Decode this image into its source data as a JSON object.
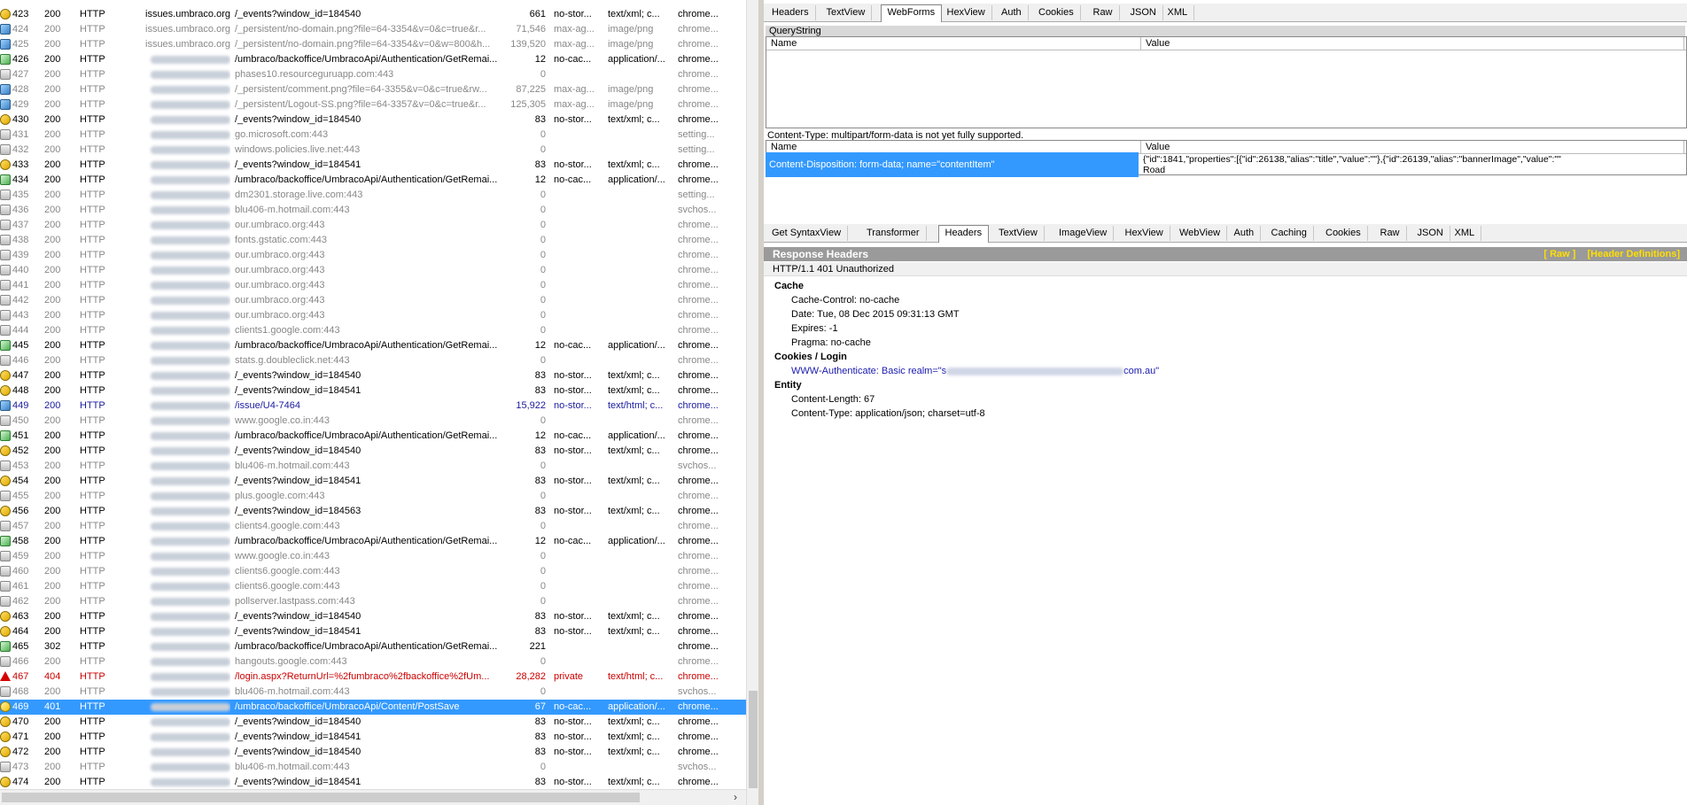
{
  "sessions": [
    {
      "num": "423",
      "result": "200",
      "protocol": "HTTP",
      "host": "issues.umbraco.org",
      "host_blurred": false,
      "url": "/_events?window_id=184540",
      "body": "661",
      "caching": "no-stor...",
      "ctype": "text/xml; c...",
      "process": "chrome...",
      "icon": "get",
      "style": "normal"
    },
    {
      "num": "424",
      "result": "200",
      "protocol": "HTTP",
      "host": "issues.umbraco.org",
      "host_blurred": false,
      "url": "/_persistent/no-domain.png?file=64-3354&v=0&c=true&r...",
      "body": "71,546",
      "caching": "max-ag...",
      "ctype": "image/png",
      "process": "chrome...",
      "icon": "img",
      "style": "dim"
    },
    {
      "num": "425",
      "result": "200",
      "protocol": "HTTP",
      "host": "issues.umbraco.org",
      "host_blurred": false,
      "url": "/_persistent/no-domain.png?file=64-3354&v=0&w=800&h...",
      "body": "139,520",
      "caching": "max-ag...",
      "ctype": "image/png",
      "process": "chrome...",
      "icon": "img",
      "style": "dim"
    },
    {
      "num": "426",
      "result": "200",
      "protocol": "HTTP",
      "host": "",
      "host_blurred": true,
      "url": "/umbraco/backoffice/UmbracoApi/Authentication/GetRemai...",
      "body": "12",
      "caching": "no-cac...",
      "ctype": "application/...",
      "process": "chrome...",
      "icon": "js",
      "style": "normal"
    },
    {
      "num": "427",
      "result": "200",
      "protocol": "HTTP",
      "host": "",
      "host_blurred": true,
      "url": "phases10.resourceguruapp.com:443",
      "body": "0",
      "caching": "",
      "ctype": "",
      "process": "chrome...",
      "icon": "lock",
      "style": "dim"
    },
    {
      "num": "428",
      "result": "200",
      "protocol": "HTTP",
      "host": "",
      "host_blurred": true,
      "url": "/_persistent/comment.png?file=64-3355&v=0&c=true&rw...",
      "body": "87,225",
      "caching": "max-ag...",
      "ctype": "image/png",
      "process": "chrome...",
      "icon": "img",
      "style": "dim"
    },
    {
      "num": "429",
      "result": "200",
      "protocol": "HTTP",
      "host": "",
      "host_blurred": true,
      "url": "/_persistent/Logout-SS.png?file=64-3357&v=0&c=true&r...",
      "body": "125,305",
      "caching": "max-ag...",
      "ctype": "image/png",
      "process": "chrome...",
      "icon": "img",
      "style": "dim"
    },
    {
      "num": "430",
      "result": "200",
      "protocol": "HTTP",
      "host": "",
      "host_blurred": true,
      "url": "/_events?window_id=184540",
      "body": "83",
      "caching": "no-stor...",
      "ctype": "text/xml; c...",
      "process": "chrome...",
      "icon": "get",
      "style": "normal"
    },
    {
      "num": "431",
      "result": "200",
      "protocol": "HTTP",
      "host": "",
      "host_blurred": true,
      "url": "go.microsoft.com:443",
      "body": "0",
      "caching": "",
      "ctype": "",
      "process": "setting...",
      "icon": "lock",
      "style": "dim"
    },
    {
      "num": "432",
      "result": "200",
      "protocol": "HTTP",
      "host": "",
      "host_blurred": true,
      "url": "windows.policies.live.net:443",
      "body": "0",
      "caching": "",
      "ctype": "",
      "process": "setting...",
      "icon": "lock",
      "style": "dim"
    },
    {
      "num": "433",
      "result": "200",
      "protocol": "HTTP",
      "host": "",
      "host_blurred": true,
      "url": "/_events?window_id=184541",
      "body": "83",
      "caching": "no-stor...",
      "ctype": "text/xml; c...",
      "process": "chrome...",
      "icon": "get",
      "style": "normal"
    },
    {
      "num": "434",
      "result": "200",
      "protocol": "HTTP",
      "host": "",
      "host_blurred": true,
      "url": "/umbraco/backoffice/UmbracoApi/Authentication/GetRemai...",
      "body": "12",
      "caching": "no-cac...",
      "ctype": "application/...",
      "process": "chrome...",
      "icon": "js",
      "style": "normal"
    },
    {
      "num": "435",
      "result": "200",
      "protocol": "HTTP",
      "host": "",
      "host_blurred": true,
      "url": "dm2301.storage.live.com:443",
      "body": "0",
      "caching": "",
      "ctype": "",
      "process": "setting...",
      "icon": "lock",
      "style": "dim"
    },
    {
      "num": "436",
      "result": "200",
      "protocol": "HTTP",
      "host": "",
      "host_blurred": true,
      "url": "blu406-m.hotmail.com:443",
      "body": "0",
      "caching": "",
      "ctype": "",
      "process": "svchos...",
      "icon": "lock",
      "style": "dim"
    },
    {
      "num": "437",
      "result": "200",
      "protocol": "HTTP",
      "host": "",
      "host_blurred": true,
      "url": "our.umbraco.org:443",
      "body": "0",
      "caching": "",
      "ctype": "",
      "process": "chrome...",
      "icon": "lock",
      "style": "dim"
    },
    {
      "num": "438",
      "result": "200",
      "protocol": "HTTP",
      "host": "",
      "host_blurred": true,
      "url": "fonts.gstatic.com:443",
      "body": "0",
      "caching": "",
      "ctype": "",
      "process": "chrome...",
      "icon": "lock",
      "style": "dim"
    },
    {
      "num": "439",
      "result": "200",
      "protocol": "HTTP",
      "host": "",
      "host_blurred": true,
      "url": "our.umbraco.org:443",
      "body": "0",
      "caching": "",
      "ctype": "",
      "process": "chrome...",
      "icon": "lock",
      "style": "dim"
    },
    {
      "num": "440",
      "result": "200",
      "protocol": "HTTP",
      "host": "",
      "host_blurred": true,
      "url": "our.umbraco.org:443",
      "body": "0",
      "caching": "",
      "ctype": "",
      "process": "chrome...",
      "icon": "lock",
      "style": "dim"
    },
    {
      "num": "441",
      "result": "200",
      "protocol": "HTTP",
      "host": "",
      "host_blurred": true,
      "url": "our.umbraco.org:443",
      "body": "0",
      "caching": "",
      "ctype": "",
      "process": "chrome...",
      "icon": "lock",
      "style": "dim"
    },
    {
      "num": "442",
      "result": "200",
      "protocol": "HTTP",
      "host": "",
      "host_blurred": true,
      "url": "our.umbraco.org:443",
      "body": "0",
      "caching": "",
      "ctype": "",
      "process": "chrome...",
      "icon": "lock",
      "style": "dim"
    },
    {
      "num": "443",
      "result": "200",
      "protocol": "HTTP",
      "host": "",
      "host_blurred": true,
      "url": "our.umbraco.org:443",
      "body": "0",
      "caching": "",
      "ctype": "",
      "process": "chrome...",
      "icon": "lock",
      "style": "dim"
    },
    {
      "num": "444",
      "result": "200",
      "protocol": "HTTP",
      "host": "",
      "host_blurred": true,
      "url": "clients1.google.com:443",
      "body": "0",
      "caching": "",
      "ctype": "",
      "process": "chrome...",
      "icon": "lock",
      "style": "dim"
    },
    {
      "num": "445",
      "result": "200",
      "protocol": "HTTP",
      "host": "",
      "host_blurred": true,
      "url": "/umbraco/backoffice/UmbracoApi/Authentication/GetRemai...",
      "body": "12",
      "caching": "no-cac...",
      "ctype": "application/...",
      "process": "chrome...",
      "icon": "js",
      "style": "normal"
    },
    {
      "num": "446",
      "result": "200",
      "protocol": "HTTP",
      "host": "",
      "host_blurred": true,
      "url": "stats.g.doubleclick.net:443",
      "body": "0",
      "caching": "",
      "ctype": "",
      "process": "chrome...",
      "icon": "lock",
      "style": "dim"
    },
    {
      "num": "447",
      "result": "200",
      "protocol": "HTTP",
      "host": "",
      "host_blurred": true,
      "url": "/_events?window_id=184540",
      "body": "83",
      "caching": "no-stor...",
      "ctype": "text/xml; c...",
      "process": "chrome...",
      "icon": "get",
      "style": "normal"
    },
    {
      "num": "448",
      "result": "200",
      "protocol": "HTTP",
      "host": "",
      "host_blurred": true,
      "url": "/_events?window_id=184541",
      "body": "83",
      "caching": "no-stor...",
      "ctype": "text/xml; c...",
      "process": "chrome...",
      "icon": "get",
      "style": "normal"
    },
    {
      "num": "449",
      "result": "200",
      "protocol": "HTTP",
      "host": "",
      "host_blurred": true,
      "url": "/issue/U4-7464",
      "body": "15,922",
      "caching": "no-stor...",
      "ctype": "text/html; c...",
      "process": "chrome...",
      "icon": "img",
      "style": "navy"
    },
    {
      "num": "450",
      "result": "200",
      "protocol": "HTTP",
      "host": "",
      "host_blurred": true,
      "url": "www.google.co.in:443",
      "body": "0",
      "caching": "",
      "ctype": "",
      "process": "chrome...",
      "icon": "lock",
      "style": "dim"
    },
    {
      "num": "451",
      "result": "200",
      "protocol": "HTTP",
      "host": "",
      "host_blurred": true,
      "url": "/umbraco/backoffice/UmbracoApi/Authentication/GetRemai...",
      "body": "12",
      "caching": "no-cac...",
      "ctype": "application/...",
      "process": "chrome...",
      "icon": "js",
      "style": "normal"
    },
    {
      "num": "452",
      "result": "200",
      "protocol": "HTTP",
      "host": "",
      "host_blurred": true,
      "url": "/_events?window_id=184540",
      "body": "83",
      "caching": "no-stor...",
      "ctype": "text/xml; c...",
      "process": "chrome...",
      "icon": "get",
      "style": "normal"
    },
    {
      "num": "453",
      "result": "200",
      "protocol": "HTTP",
      "host": "",
      "host_blurred": true,
      "url": "blu406-m.hotmail.com:443",
      "body": "0",
      "caching": "",
      "ctype": "",
      "process": "svchos...",
      "icon": "lock",
      "style": "dim"
    },
    {
      "num": "454",
      "result": "200",
      "protocol": "HTTP",
      "host": "",
      "host_blurred": true,
      "url": "/_events?window_id=184541",
      "body": "83",
      "caching": "no-stor...",
      "ctype": "text/xml; c...",
      "process": "chrome...",
      "icon": "get",
      "style": "normal"
    },
    {
      "num": "455",
      "result": "200",
      "protocol": "HTTP",
      "host": "",
      "host_blurred": true,
      "url": "plus.google.com:443",
      "body": "0",
      "caching": "",
      "ctype": "",
      "process": "chrome...",
      "icon": "lock",
      "style": "dim"
    },
    {
      "num": "456",
      "result": "200",
      "protocol": "HTTP",
      "host": "",
      "host_blurred": true,
      "url": "/_events?window_id=184563",
      "body": "83",
      "caching": "no-stor...",
      "ctype": "text/xml; c...",
      "process": "chrome...",
      "icon": "get",
      "style": "normal"
    },
    {
      "num": "457",
      "result": "200",
      "protocol": "HTTP",
      "host": "",
      "host_blurred": true,
      "url": "clients4.google.com:443",
      "body": "0",
      "caching": "",
      "ctype": "",
      "process": "chrome...",
      "icon": "lock",
      "style": "dim"
    },
    {
      "num": "458",
      "result": "200",
      "protocol": "HTTP",
      "host": "",
      "host_blurred": true,
      "url": "/umbraco/backoffice/UmbracoApi/Authentication/GetRemai...",
      "body": "12",
      "caching": "no-cac...",
      "ctype": "application/...",
      "process": "chrome...",
      "icon": "js",
      "style": "normal"
    },
    {
      "num": "459",
      "result": "200",
      "protocol": "HTTP",
      "host": "",
      "host_blurred": true,
      "url": "www.google.co.in:443",
      "body": "0",
      "caching": "",
      "ctype": "",
      "process": "chrome...",
      "icon": "lock",
      "style": "dim"
    },
    {
      "num": "460",
      "result": "200",
      "protocol": "HTTP",
      "host": "",
      "host_blurred": true,
      "url": "clients6.google.com:443",
      "body": "0",
      "caching": "",
      "ctype": "",
      "process": "chrome...",
      "icon": "lock",
      "style": "dim"
    },
    {
      "num": "461",
      "result": "200",
      "protocol": "HTTP",
      "host": "",
      "host_blurred": true,
      "url": "clients6.google.com:443",
      "body": "0",
      "caching": "",
      "ctype": "",
      "process": "chrome...",
      "icon": "lock",
      "style": "dim"
    },
    {
      "num": "462",
      "result": "200",
      "protocol": "HTTP",
      "host": "",
      "host_blurred": true,
      "url": "pollserver.lastpass.com:443",
      "body": "0",
      "caching": "",
      "ctype": "",
      "process": "chrome...",
      "icon": "lock",
      "style": "dim"
    },
    {
      "num": "463",
      "result": "200",
      "protocol": "HTTP",
      "host": "",
      "host_blurred": true,
      "url": "/_events?window_id=184540",
      "body": "83",
      "caching": "no-stor...",
      "ctype": "text/xml; c...",
      "process": "chrome...",
      "icon": "get",
      "style": "normal"
    },
    {
      "num": "464",
      "result": "200",
      "protocol": "HTTP",
      "host": "",
      "host_blurred": true,
      "url": "/_events?window_id=184541",
      "body": "83",
      "caching": "no-stor...",
      "ctype": "text/xml; c...",
      "process": "chrome...",
      "icon": "get",
      "style": "normal"
    },
    {
      "num": "465",
      "result": "302",
      "protocol": "HTTP",
      "host": "",
      "host_blurred": true,
      "url": "/umbraco/backoffice/UmbracoApi/Authentication/GetRemai...",
      "body": "221",
      "caching": "",
      "ctype": "",
      "process": "chrome...",
      "icon": "js",
      "style": "normal"
    },
    {
      "num": "466",
      "result": "200",
      "protocol": "HTTP",
      "host": "",
      "host_blurred": true,
      "url": "hangouts.google.com:443",
      "body": "0",
      "caching": "",
      "ctype": "",
      "process": "chrome...",
      "icon": "lock",
      "style": "dim"
    },
    {
      "num": "467",
      "result": "404",
      "protocol": "HTTP",
      "host": "",
      "host_blurred": true,
      "url": "/login.aspx?ReturnUrl=%2fumbraco%2fbackoffice%2fUm...",
      "body": "28,282",
      "caching": "private",
      "ctype": "text/html; c...",
      "process": "chrome...",
      "icon": "warn",
      "style": "red"
    },
    {
      "num": "468",
      "result": "200",
      "protocol": "HTTP",
      "host": "",
      "host_blurred": true,
      "url": "blu406-m.hotmail.com:443",
      "body": "0",
      "caching": "",
      "ctype": "",
      "process": "svchos...",
      "icon": "lock",
      "style": "dim"
    },
    {
      "num": "469",
      "result": "401",
      "protocol": "HTTP",
      "host": "",
      "host_blurred": true,
      "url": "/umbraco/backoffice/UmbracoApi/Content/PostSave",
      "body": "67",
      "caching": "no-cac...",
      "ctype": "application/...",
      "process": "chrome...",
      "icon": "key",
      "style": "sel"
    },
    {
      "num": "470",
      "result": "200",
      "protocol": "HTTP",
      "host": "",
      "host_blurred": true,
      "url": "/_events?window_id=184540",
      "body": "83",
      "caching": "no-stor...",
      "ctype": "text/xml; c...",
      "process": "chrome...",
      "icon": "get",
      "style": "normal"
    },
    {
      "num": "471",
      "result": "200",
      "protocol": "HTTP",
      "host": "",
      "host_blurred": true,
      "url": "/_events?window_id=184541",
      "body": "83",
      "caching": "no-stor...",
      "ctype": "text/xml; c...",
      "process": "chrome...",
      "icon": "get",
      "style": "normal"
    },
    {
      "num": "472",
      "result": "200",
      "protocol": "HTTP",
      "host": "",
      "host_blurred": true,
      "url": "/_events?window_id=184540",
      "body": "83",
      "caching": "no-stor...",
      "ctype": "text/xml; c...",
      "process": "chrome...",
      "icon": "get",
      "style": "normal"
    },
    {
      "num": "473",
      "result": "200",
      "protocol": "HTTP",
      "host": "",
      "host_blurred": true,
      "url": "blu406-m.hotmail.com:443",
      "body": "0",
      "caching": "",
      "ctype": "",
      "process": "svchos...",
      "icon": "lock",
      "style": "dim"
    },
    {
      "num": "474",
      "result": "200",
      "protocol": "HTTP",
      "host": "",
      "host_blurred": true,
      "url": "/_events?window_id=184541",
      "body": "83",
      "caching": "no-stor...",
      "ctype": "text/xml; c...",
      "process": "chrome...",
      "icon": "get",
      "style": "normal"
    }
  ],
  "request_tabs": [
    "Headers",
    "TextView",
    "WebForms",
    "HexView",
    "Auth",
    "Cookies",
    "Raw",
    "JSON",
    "XML"
  ],
  "request_active_tab": "WebForms",
  "querystring": {
    "title": "QueryString",
    "col_name": "Name",
    "col_value": "Value"
  },
  "form": {
    "note": "Content-Type: multipart/form-data is not yet fully supported.",
    "col_name": "Name",
    "col_value": "Value",
    "row_name": "Content-Disposition: form-data; name=\"contentItem\"",
    "row_value_line1": "{\"id\":1841,\"properties\":[{\"id\":26138,\"alias\":\"title\",\"value\":\"\"},{\"id\":26139,\"alias\":\"bannerImage\",\"value\":\"\"",
    "row_value_line2": "Road"
  },
  "response_tabs": [
    "Get SyntaxView",
    "Transformer",
    "Headers",
    "TextView",
    "ImageView",
    "HexView",
    "WebView",
    "Auth",
    "Caching",
    "Cookies",
    "Raw",
    "JSON",
    "XML"
  ],
  "response_active_tab": "Headers",
  "response": {
    "title": "Response Headers",
    "raw_link": "[ Raw ]",
    "defs_link": "[Header Definitions]",
    "status": "HTTP/1.1 401 Unauthorized",
    "section_cache": "Cache",
    "cache_control": "Cache-Control: no-cache",
    "date": "Date: Tue, 08 Dec 2015 09:31:13 GMT",
    "expires": "Expires: -1",
    "pragma": "Pragma: no-cache",
    "section_cookies": "Cookies / Login",
    "www_auth_prefix": "WWW-Authenticate: Basic realm=\"s",
    "www_auth_suffix": "com.au\"",
    "section_entity": "Entity",
    "content_length": "Content-Length: 67",
    "content_type": "Content-Type: application/json; charset=utf-8"
  },
  "colors": {
    "selection": "#3399ff",
    "error_text": "#cc0000",
    "link_text": "#1a1ab0",
    "header_bar": "#9a9a9a",
    "header_links": "#ffde00"
  },
  "icons": {
    "h_scroll_right": "›"
  }
}
